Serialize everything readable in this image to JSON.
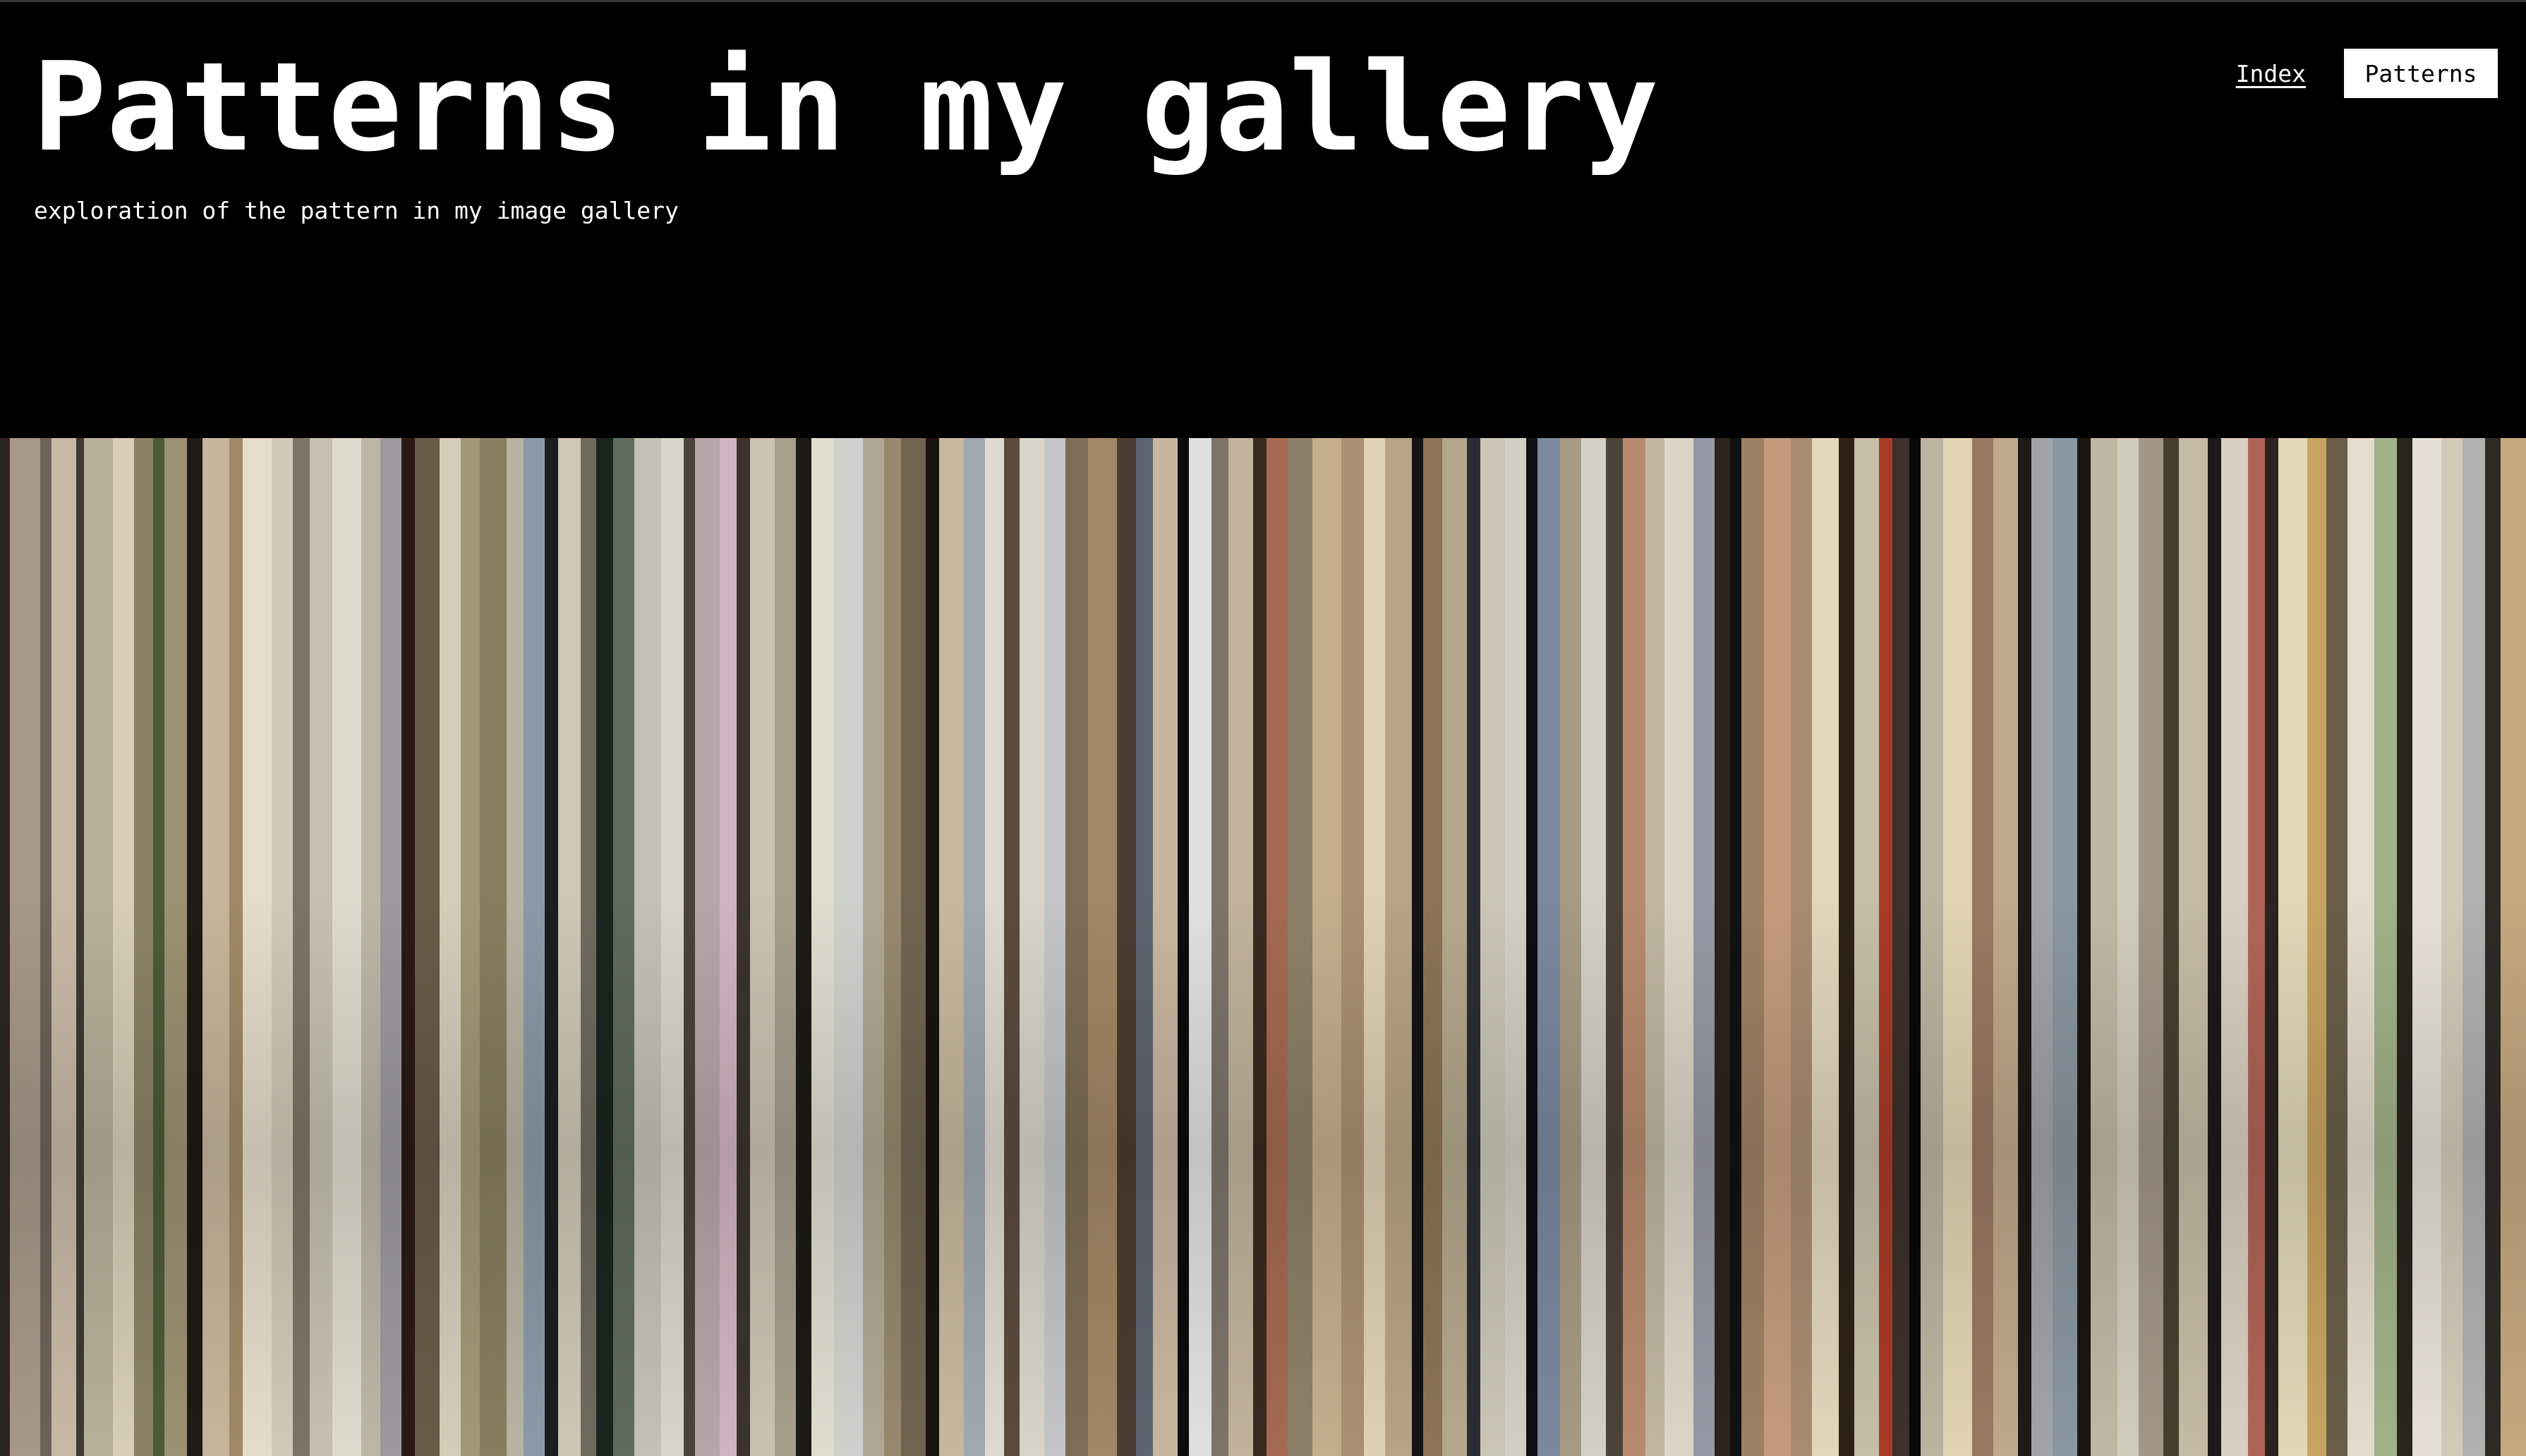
{
  "page": {
    "title": "Patterns in my gallery",
    "subtitle": "exploration of the pattern in my image gallery"
  },
  "nav": {
    "items": [
      {
        "label": "Index",
        "active": false
      },
      {
        "label": "Patterns",
        "active": true
      }
    ]
  },
  "theme": {
    "background": "#000000",
    "text": "#ffffff",
    "active_nav_bg": "#ffffff",
    "active_nav_text": "#000000"
  },
  "pattern_colors": [
    "#2b2622",
    "#a89888",
    "#6e6258",
    "#c9b9a7",
    "#3e3a33",
    "#b7b09a",
    "#d7cdb8",
    "#8b8266",
    "#4c5a38",
    "#9d9072",
    "#1e1a15",
    "#c7b59b",
    "#a08a66",
    "#e5dcc9",
    "#d1c9b6",
    "#7b7565",
    "#c6c0b0",
    "#dedacd",
    "#bdb6a5",
    "#9c9aa0",
    "#2a1a14",
    "#6a5a48",
    "#d6ccba",
    "#a39877",
    "#877d5f",
    "#b9b3a3",
    "#8a9aa8",
    "#1a1e20",
    "#cfc7b4",
    "#6f6a5e",
    "#1a2520",
    "#5f6b5d",
    "#c4c2b6",
    "#d8d5cc",
    "#4a4338",
    "#b7a6a8",
    "#d2b4c0",
    "#3b332c",
    "#cbc3b1",
    "#a79e8c",
    "#1b1a17",
    "#e0dcd0",
    "#cfd2cc",
    "#b0a894",
    "#97886e",
    "#726452",
    "#1a1410",
    "#c8b89d",
    "#a0a8b0",
    "#dedad1",
    "#5a4b3c",
    "#d8d4ca",
    "#c2c6c6",
    "#7e6d56",
    "#a28864",
    "#4a3c30",
    "#5d6570",
    "#c9b6a0",
    "#0c0c0c",
    "#dfe1e0",
    "#7c7468",
    "#c2b29c",
    "#3a2a20",
    "#a56a50",
    "#8e8068",
    "#c4ae8c",
    "#aa9070",
    "#e0d0b4",
    "#b8a482",
    "#141414",
    "#8c7454",
    "#b4a88c",
    "#2a2e34",
    "#cbc6b6",
    "#d2cfc4",
    "#0f0f12",
    "#7b88a0",
    "#a89a84",
    "#d4d0c6",
    "#4c4338",
    "#b88a6c",
    "#c0b6a2",
    "#dcd6c8",
    "#969aa6",
    "#2b241c",
    "#111111",
    "#9e8064",
    "#c39c7c",
    "#a88c70",
    "#e2d6bc",
    "#2e2218",
    "#c6bea8",
    "#a93a26",
    "#3e302a",
    "#080808",
    "#bcb3a0",
    "#e2d4b2",
    "#9b7862",
    "#c0a88a",
    "#1c1a16",
    "#a0a4a8",
    "#8a96a0",
    "#1a1612",
    "#c0b8a4",
    "#d2ccbc",
    "#a29686",
    "#48402f",
    "#c5bba5",
    "#1c1a18",
    "#d8d0c0",
    "#b06458",
    "#2a2420",
    "#e2d8b8",
    "#c8a460",
    "#6a5e48",
    "#e4dccc",
    "#a1b288",
    "#28241e",
    "#e6e0d6",
    "#d5cab8",
    "#b0b2b0",
    "#2e2a26",
    "#c6a880"
  ],
  "pattern_widths": [
    10,
    32,
    12,
    26,
    8,
    30,
    22,
    20,
    12,
    24,
    16,
    28,
    14,
    30,
    22,
    18,
    24,
    30,
    20,
    22,
    14,
    26,
    22,
    20,
    28,
    18,
    22,
    14,
    24,
    16,
    18,
    22,
    28,
    24,
    12,
    26,
    18,
    14,
    26,
    22,
    16,
    24,
    30,
    22,
    18,
    26,
    14,
    26,
    22,
    20,
    16,
    26,
    22,
    24,
    30,
    20,
    18,
    26,
    12,
    24,
    18,
    26,
    14,
    22,
    26,
    30,
    24,
    22,
    28,
    12,
    20,
    26,
    14,
    26,
    22,
    12,
    24,
    22,
    26,
    18,
    24,
    20,
    30,
    22,
    16,
    12,
    24,
    28,
    22,
    28,
    16,
    26,
    14,
    18,
    12,
    24,
    30,
    22,
    26,
    14,
    22,
    26,
    14,
    28,
    22,
    26,
    16,
    30,
    14,
    28,
    18,
    14,
    30,
    20,
    22,
    28,
    24,
    16,
    30,
    22,
    24,
    16,
    30
  ]
}
